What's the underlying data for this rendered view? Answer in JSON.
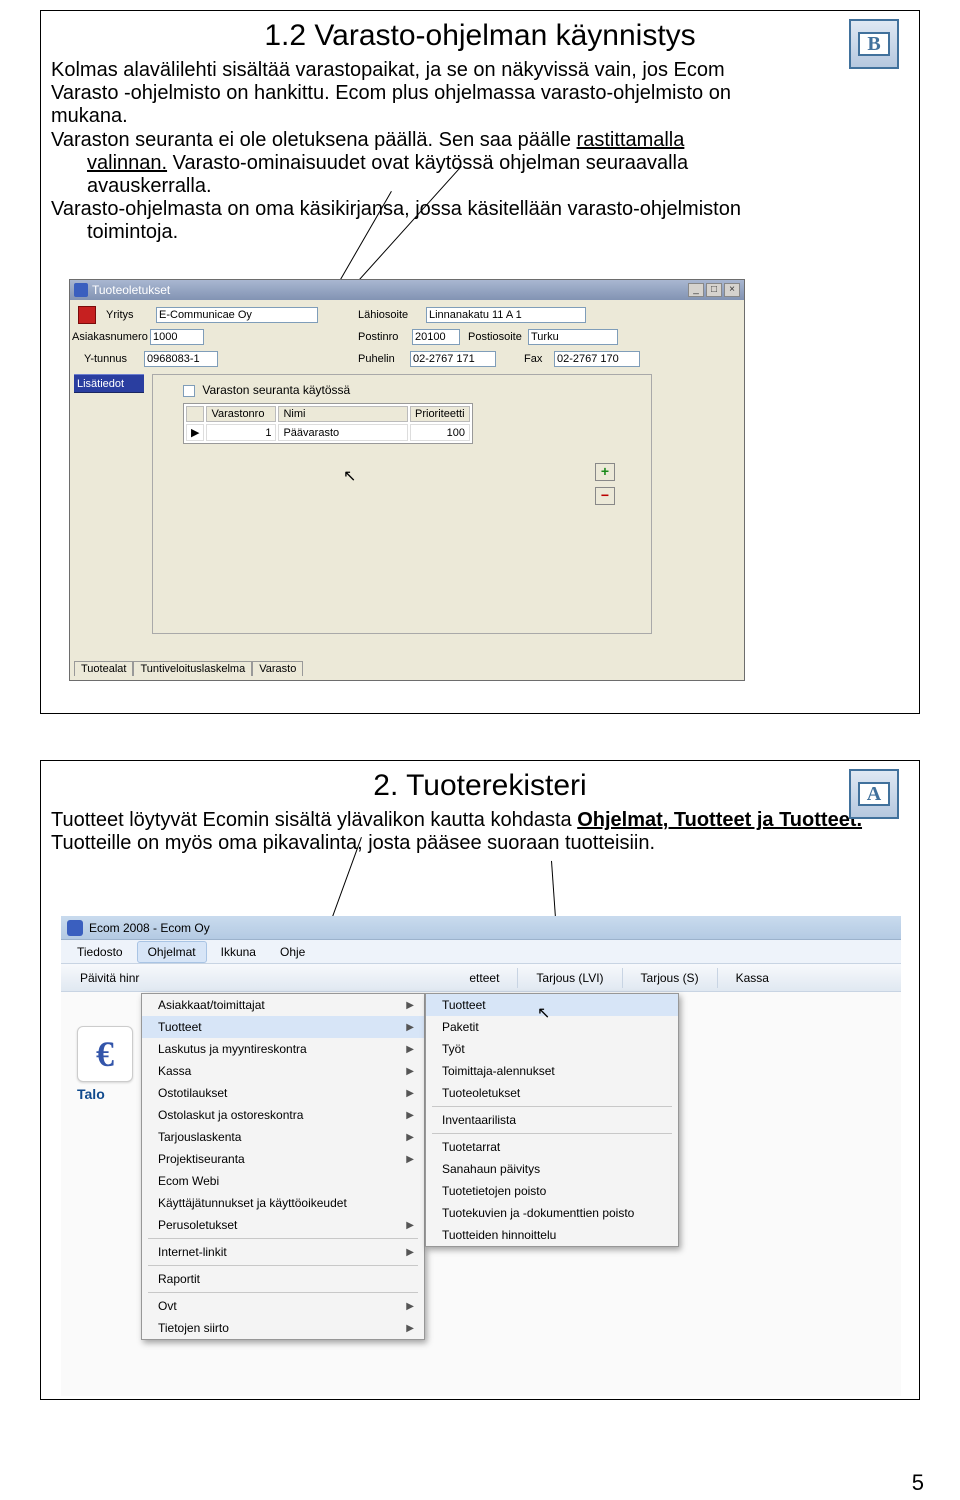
{
  "page_number": "5",
  "section1": {
    "icon_letter": "B",
    "title": "1.2 Varasto-ohjelman käynnistys",
    "para1a": "Kolmas alavälilehti sisältää varastopaikat, ja se on näkyvissä vain, jos Ecom",
    "para1b": "Varasto -ohjelmisto on hankittu. Ecom plus ohjelmassa varasto-ohjelmisto on",
    "para1c": "mukana.",
    "para2a": "Varaston seuranta ei ole oletuksena päällä. Sen saa päälle ",
    "para2a_u": "rastittamalla",
    "para2b_u": "valinnan.",
    "para2b": " Varasto-ominaisuudet ovat käytössä ohjelman seuraavalla",
    "para2c": "avauskerralla.",
    "para3a": "Varasto-ohjelmasta on oma käsikirjansa, jossa käsitellään varasto-ohjelmiston",
    "para3b": "toimintoja."
  },
  "win1": {
    "title": "Tuoteoletukset",
    "labels": {
      "yritys": "Yritys",
      "asiakasnumero": "Asiakasnumero",
      "ytunnus": "Y-tunnus",
      "lahiosoite": "Lähiosoite",
      "postinro": "Postinro",
      "postiosoite": "Postiosoite",
      "puhelin": "Puhelin",
      "fax": "Fax"
    },
    "values": {
      "yritys": "E-Communicae Oy",
      "asiakasnumero": "1000",
      "ytunnus": "0968083-1",
      "lahiosoite": "Linnanakatu 11 A 1",
      "postinro": "20100",
      "postiosoite": "Turku",
      "puhelin": "02-2767 171",
      "fax": "02-2767 170"
    },
    "sidebar_btn": "Lisätiedot",
    "checkbox_label": "Varaston seuranta käytössä",
    "table_headers": {
      "varastonro": "Varastonro",
      "nimi": "Nimi",
      "prioriteetti": "Prioriteetti"
    },
    "table_row": {
      "varastonro": "1",
      "nimi": "Päävarasto",
      "prioriteetti": "100"
    },
    "tabs": {
      "t1": "Tuotealat",
      "t2": "Tuntiveloituslaskelma",
      "t3": "Varasto"
    }
  },
  "section2": {
    "icon_letter": "A",
    "title": "2. Tuoterekisteri",
    "p1a": "Tuotteet löytyvät Ecomin sisältä ylävalikon kautta kohdasta ",
    "p1b": "Ohjelmat, Tuotteet ja Tuotteet.",
    "p2": "Tuotteille on myös oma pikavalinta, josta pääsee suoraan tuotteisiin."
  },
  "win2": {
    "title": "Ecom 2008 - Ecom Oy",
    "menubar": {
      "m1": "Tiedosto",
      "m2": "Ohjelmat",
      "m3": "Ikkuna",
      "m4": "Ohje"
    },
    "toolbar": {
      "b1": "Päivitä hinr",
      "b2": "etteet",
      "b3": "Tarjous (LVI)",
      "b4": "Tarjous (S)",
      "b5": "Kassa"
    },
    "bodylabel": "Talo",
    "dd1": [
      {
        "t": "Asiakkaat/toimittajat",
        "arrow": true
      },
      {
        "t": "Tuotteet",
        "arrow": true,
        "hover": true
      },
      {
        "t": "Laskutus ja myyntireskontra",
        "arrow": true
      },
      {
        "t": "Kassa",
        "arrow": true
      },
      {
        "t": "Ostotilaukset",
        "arrow": true
      },
      {
        "t": "Ostolaskut ja ostoreskontra",
        "arrow": true
      },
      {
        "t": "Tarjouslaskenta",
        "arrow": true
      },
      {
        "t": "Projektiseuranta",
        "arrow": true
      },
      {
        "t": "Ecom Webi"
      },
      {
        "t": "Käyttäjätunnukset ja käyttöoikeudet"
      },
      {
        "t": "Perusoletukset",
        "arrow": true
      },
      {
        "sep": true
      },
      {
        "t": "Internet-linkit",
        "arrow": true
      },
      {
        "sep": true
      },
      {
        "t": "Raportit"
      },
      {
        "sep": true
      },
      {
        "t": "Ovt",
        "arrow": true
      },
      {
        "t": "Tietojen siirto",
        "arrow": true
      }
    ],
    "dd2": [
      {
        "t": "Tuotteet",
        "hover": true
      },
      {
        "t": "Paketit"
      },
      {
        "t": "Työt"
      },
      {
        "t": "Toimittaja-alennukset"
      },
      {
        "t": "Tuoteoletukset"
      },
      {
        "sep": true
      },
      {
        "t": "Inventaarilista"
      },
      {
        "sep": true
      },
      {
        "t": "Tuotetarrat"
      },
      {
        "t": "Sanahaun päivitys"
      },
      {
        "t": "Tuotetietojen poisto"
      },
      {
        "t": "Tuotekuvien ja -dokumenttien poisto"
      },
      {
        "t": "Tuotteiden hinnoittelu"
      }
    ]
  }
}
